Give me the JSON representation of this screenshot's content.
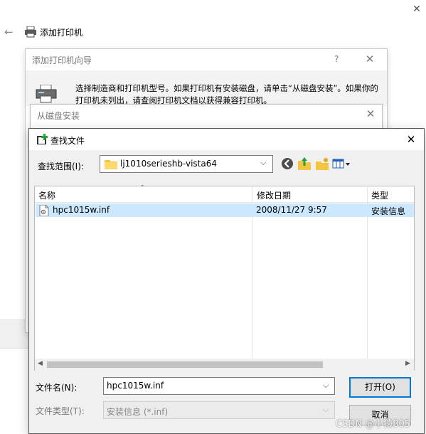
{
  "background": {
    "title": "添加打印机",
    "close_glyph": "✕",
    "back_glyph": "←"
  },
  "wizard": {
    "title": "添加打印机向导",
    "help_glyph": "?",
    "close_glyph": "✕",
    "description": "选择制造商和打印机型号。如果打印机有安装磁盘，请单击“从磁盘安装”。如果你的打印机未列出，请查阅打印机文档以获得兼容打印机。"
  },
  "disk_dialog": {
    "title": "从磁盘安装",
    "close_glyph": "✕"
  },
  "open_dialog": {
    "title": "查找文件",
    "close_glyph": "✕",
    "look_in_label": "查找范围(I):",
    "look_in_value": "lj1010serieshb-vista64",
    "toolbar": {
      "back_icon": "back-icon",
      "up_icon": "up-folder-icon",
      "new_folder_icon": "new-folder-icon",
      "view_icon": "view-menu-icon"
    },
    "columns": {
      "name": "名称",
      "date": "修改日期",
      "type": "类型"
    },
    "files": [
      {
        "name": "hpc1015w.inf",
        "date": "2008/11/27 9:57",
        "type": "安装信息",
        "selected": true
      }
    ],
    "file_name_label": "文件名(N):",
    "file_name_value": "hpc1015w.inf",
    "file_type_label": "文件类型(T):",
    "file_type_value": "安装信息 (*.inf)",
    "open_label": "打开(O)",
    "cancel_label": "取消"
  },
  "watermark": "CSDN @小猿805",
  "colors": {
    "selection": "#cce8ff",
    "focus_border": "#0078d7",
    "dialog_bg": "#f0f0f0"
  }
}
